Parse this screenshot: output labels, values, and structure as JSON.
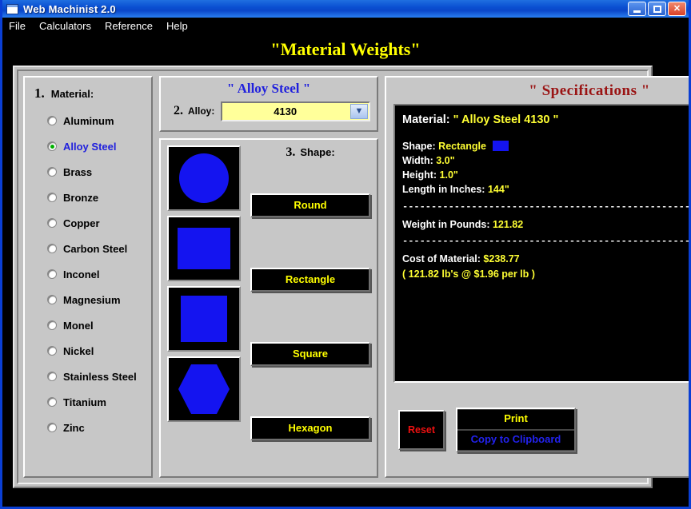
{
  "window": {
    "title": "Web Machinist 2.0",
    "icon": "window-icon",
    "buttons": {
      "minimize": "minimize",
      "maximize": "maximize",
      "close": "close"
    }
  },
  "menubar": {
    "items": [
      "File",
      "Calculators",
      "Reference",
      "Help"
    ]
  },
  "page": {
    "title": "\"Material Weights\""
  },
  "material": {
    "step": "1.",
    "label": "Material:",
    "selected": "Alloy Steel",
    "options": [
      "Aluminum",
      "Alloy Steel",
      "Brass",
      "Bronze",
      "Copper",
      "Carbon Steel",
      "Inconel",
      "Magnesium",
      "Monel",
      "Nickel",
      "Stainless Steel",
      "Titanium",
      "Zinc"
    ]
  },
  "alloy": {
    "title": "\" Alloy Steel \"",
    "step": "2.",
    "label": "Alloy:",
    "value": "4130",
    "arrow": "chevron-down-icon"
  },
  "shape": {
    "step": "3.",
    "label": "Shape:",
    "buttons": [
      "Round",
      "Rectangle",
      "Square",
      "Hexagon"
    ],
    "previews": [
      "round",
      "rectangle",
      "square",
      "hexagon"
    ]
  },
  "spec": {
    "title": "\" Specifications \"",
    "material_label": "Material:",
    "material_value": "\" Alloy Steel 4130 \"",
    "rows": [
      {
        "label": "Shape:",
        "value": "Rectangle",
        "swatch": "#1414f0"
      },
      {
        "label": "Width:",
        "value": "3.0\""
      },
      {
        "label": "Height:",
        "value": "1.0\""
      },
      {
        "label": "Length in Inches:",
        "value": "144\""
      }
    ],
    "divider": "-----------------------------------------------------------------",
    "weight_label": "Weight in Pounds:",
    "weight_value": "121.82",
    "cost_label": "Cost of Material:",
    "cost_value": "$238.77",
    "cost_detail": "( 121.82 lb's @ $1.96 per lb )"
  },
  "actions": {
    "reset": "Reset",
    "print": "Print",
    "copy": "Copy to Clipboard"
  },
  "colors": {
    "title_yellow": "#ffff00",
    "accent_blue": "#2020dd",
    "spec_red": "#9a1414",
    "shape_blue": "#1414f0",
    "alloy_field": "#ffff9a",
    "reset_red": "#ee1111"
  }
}
